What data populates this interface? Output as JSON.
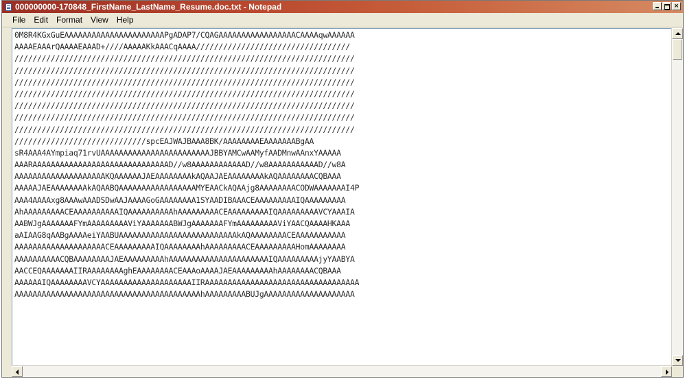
{
  "window": {
    "title": "000000000-170848_FirstName_LastName_Resume.doc.txt - Notepad",
    "title_color": "#ffffff",
    "titlebar_color": "#b8472e"
  },
  "menu": {
    "file": "File",
    "edit": "Edit",
    "format": "Format",
    "view": "View",
    "help": "Help"
  },
  "content": {
    "lines": [
      "0M8R4KGxGuEAAAAAAAAAAAAAAAAAAAAAAPgADAP7/CQAGAAAAAAAAAAAAAAAAACAAAAqwAAAAAA",
      "AAAAEAAArQAAAAEAAAD+////AAAAAKkAAACqAAAA//////////////////////////////////",
      "///////////////////////////////////////////////////////////////////////////",
      "///////////////////////////////////////////////////////////////////////////",
      "///////////////////////////////////////////////////////////////////////////",
      "///////////////////////////////////////////////////////////////////////////",
      "///////////////////////////////////////////////////////////////////////////",
      "///////////////////////////////////////////////////////////////////////////",
      "///////////////////////////////////////////////////////////////////////////",
      "/////////////////////////////spcEAJWAJBAAA8BK/AAAAAAAAEAAAAAAABgAA",
      "sR4AAA4AYmpiaq71rvUAAAAAAAAAAAAAAAAAAAAAAAAJBBYAMCwAAMyfAADMnwAAnxYAAAAA",
      "AAARAAAAAAAAAAAAAAAAAAAAAAAAAAAAAAD//w8AAAAAAAAAAAAD//w8AAAAAAAAAAAD//w8A",
      "AAAAAAAAAAAAAAAAAAAAKQAAAAAAJAEAAAAAAAAkAQAAJAEAAAAAAAAkAQAAAAAAAACQBAAA",
      "AAAAAJAEAAAAAAAAkAQAABQAAAAAAAAAAAAAAAAAMYEAACkAQAAjg8AAAAAAAACODWAAAAAAAI4P",
      "AAA4AAAAxg8AAAwAAADSDwAAJAAAAGoGAAAAAAAA1SYAADIBAAACEAAAAAAAAAIQAAAAAAAAA",
      "AhAAAAAAAAACEAAAAAAAAAAIQAAAAAAAAAAhAAAAAAAAACEAAAAAAAAAIQAAAAAAAAAVCYAAAIA",
      "AABWJgAAAAAAAFYmAAAAAAAAAViYAAAAAAABWJgAAAAAAAFYmAAAAAAAAAViYAACQAAAAHKAAA",
      "aAIAAG8qAABgAAAAeiYAABUAAAAAAAAAAAAAAAAAAAAAAAAAAkAQAAAAAAAACEAAAAAAAAAAA",
      "AAAAAAAAAAAAAAAAAAAACEAAAAAAAAAIQAAAAAAAAhAAAAAAAAACEAAAAAAAAAHomAAAAAAAA",
      "AAAAAAAAAACQBAAAAAAAAJAEAAAAAAAAAhAAAAAAAAAAAAAAAAAAAAAAIQAAAAAAAAAjyYAABYA",
      "AACCEQAAAAAAAIIRAAAAAAAAghEAAAAAAAACEAAAoAAAAJAEAAAAAAAAAhAAAAAAAACQBAAA",
      "AAAAAAIQAAAAAAAAVCYAAAAAAAAAAAAAAAAAAAAIIRAAAAAAAAAAAAAAAAAAAAAAAAAAAAAAAAAA",
      "AAAAAAAAAAAAAAAAAAAAAAAAAAAAAAAAAAAAAAAAAhAAAAAAAAABUJgAAAAAAAAAAAAAAAAAAAA"
    ]
  }
}
